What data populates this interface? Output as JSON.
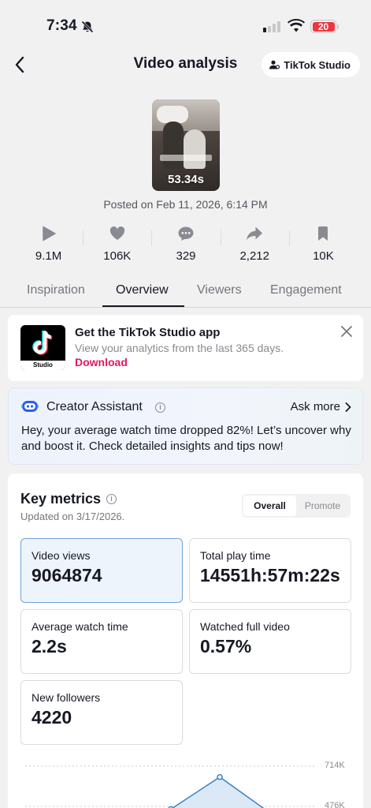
{
  "status_bar": {
    "time": "7:34",
    "battery": "20"
  },
  "header": {
    "title": "Video analysis",
    "studio_label": "TikTok Studio"
  },
  "video": {
    "duration": "53.34s",
    "posted": "Posted on Feb 11, 2026, 6:14 PM"
  },
  "stats": [
    {
      "icon": "play-icon",
      "value": "9.1M"
    },
    {
      "icon": "heart-icon",
      "value": "106K"
    },
    {
      "icon": "comment-icon",
      "value": "329"
    },
    {
      "icon": "share-icon",
      "value": "2,212"
    },
    {
      "icon": "bookmark-icon",
      "value": "10K"
    }
  ],
  "tabs": [
    {
      "label": "Inspiration",
      "active": false
    },
    {
      "label": "Overview",
      "active": true
    },
    {
      "label": "Viewers",
      "active": false
    },
    {
      "label": "Engagement",
      "active": false
    }
  ],
  "promo": {
    "title": "Get the TikTok Studio app",
    "subtitle": "View your analytics from the last 365 days.",
    "link": "Download",
    "icon_label": "Studio"
  },
  "assistant": {
    "title": "Creator Assistant",
    "ask_more": "Ask more",
    "body": "Hey, your average watch time dropped 82%! Let’s uncover why and boost it. Check detailed insights and tips now!"
  },
  "key_metrics": {
    "title": "Key metrics",
    "updated": "Updated on 3/17/2026.",
    "toggle": [
      "Overall",
      "Promote"
    ],
    "toggle_selected": "Overall",
    "items": [
      {
        "label": "Video views",
        "value": "9064874",
        "selected": true
      },
      {
        "label": "Total play time",
        "value": "14551h:57m:22s",
        "selected": false
      },
      {
        "label": "Average watch time",
        "value": "2.2s",
        "selected": false
      },
      {
        "label": "Watched full video",
        "value": "0.57%",
        "selected": false
      },
      {
        "label": "New followers",
        "value": "4220",
        "selected": false
      }
    ]
  },
  "chart_data": {
    "type": "area",
    "y_tick_labels": [
      "714K",
      "476K"
    ],
    "series": [
      {
        "values": [
          460000,
          650000,
          440000
        ]
      }
    ],
    "colors": {
      "line": "#3b82c4",
      "fill": "#dbe9f7"
    }
  },
  "colors": {
    "accent": "#e3185a",
    "selected_border": "#6fa2d9",
    "battery": "#e9383f"
  }
}
